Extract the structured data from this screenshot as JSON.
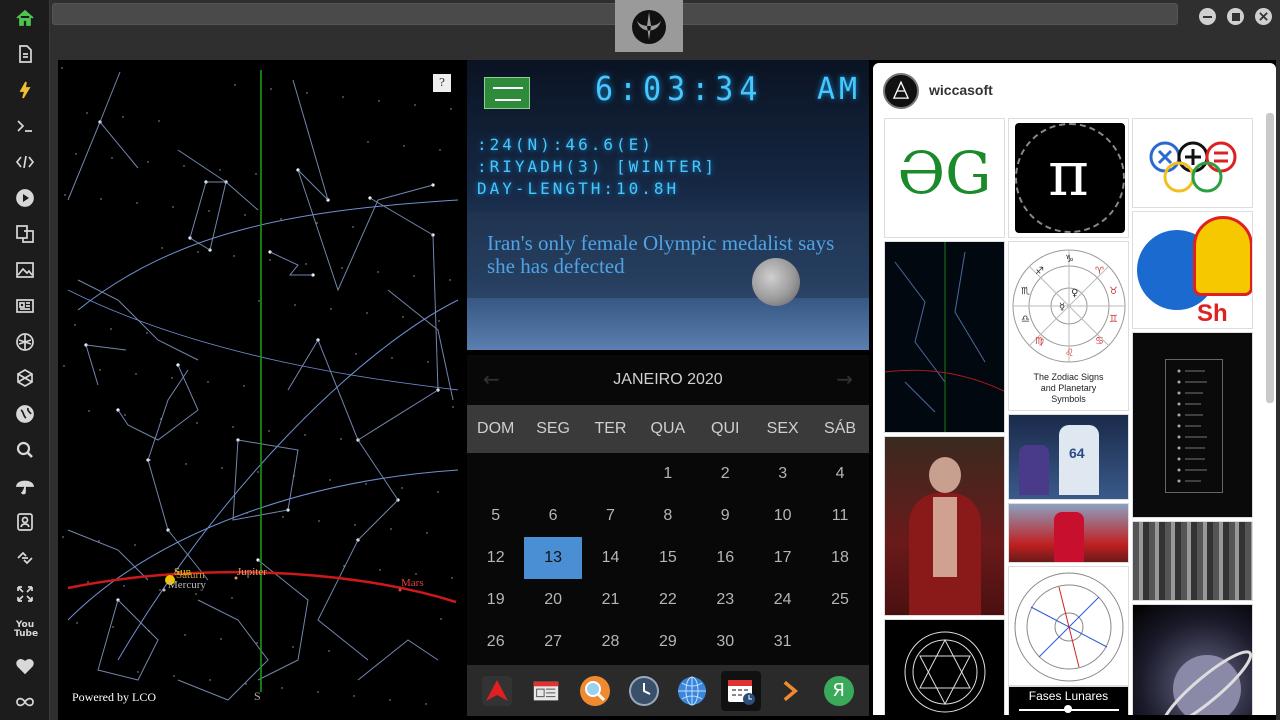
{
  "sidebar": {
    "items": [
      {
        "name": "home",
        "icon": "home-icon"
      },
      {
        "name": "document",
        "icon": "document-icon"
      },
      {
        "name": "lightning",
        "icon": "lightning-icon"
      },
      {
        "name": "terminal",
        "icon": "terminal-icon"
      },
      {
        "name": "code",
        "icon": "code-icon"
      },
      {
        "name": "play",
        "icon": "play-icon"
      },
      {
        "name": "translate",
        "icon": "translate-icon"
      },
      {
        "name": "image",
        "icon": "image-icon"
      },
      {
        "name": "news",
        "icon": "news-icon"
      },
      {
        "name": "rebel",
        "icon": "rebel-icon"
      },
      {
        "name": "hexagon",
        "icon": "hexagon-icon"
      },
      {
        "name": "globe",
        "icon": "globe-icon"
      },
      {
        "name": "search",
        "icon": "search-icon"
      },
      {
        "name": "umbrella",
        "icon": "umbrella-icon"
      },
      {
        "name": "contacts",
        "icon": "contacts-icon"
      },
      {
        "name": "link",
        "icon": "link-icon"
      },
      {
        "name": "fullscreen",
        "icon": "fullscreen-icon"
      },
      {
        "name": "youtube",
        "icon": "youtube-icon",
        "label": "You Tube"
      },
      {
        "name": "heart",
        "icon": "heart-icon"
      },
      {
        "name": "infinity",
        "icon": "infinity-icon"
      }
    ]
  },
  "skymap": {
    "help_label": "?",
    "powered_by": "Powered by LCO",
    "compass_south": "S",
    "planets": [
      {
        "label": "Sun",
        "color": "#f2c200"
      },
      {
        "label": "Saturn",
        "color": "#c8a040"
      },
      {
        "label": "Mercury",
        "color": "#bbbbbb"
      },
      {
        "label": "Jupiter",
        "color": "#d8a070"
      },
      {
        "label": "Mars",
        "color": "#e04040"
      }
    ],
    "colors": {
      "constellation": "#8fa8d8",
      "ecliptic": "#cc1a1a",
      "meridian": "#1a9a1a"
    }
  },
  "clock": {
    "time": "6:03:34",
    "ampm": "AM",
    "coords": ":24(N):46.6(E)",
    "location": ":RIYADH(3) [WINTER]",
    "day_length": "DAY-LENGTH:10.8H",
    "news": "Iran's only female Olympic medalist says she has defected",
    "flag_icon": "saudi-flag-icon"
  },
  "calendar": {
    "month_label": "JANEIRO 2020",
    "prev_icon": "arrow-left-icon",
    "next_icon": "arrow-right-icon",
    "weekdays": [
      "DOM",
      "SEG",
      "TER",
      "QUA",
      "QUI",
      "SEX",
      "SÁB"
    ],
    "weeks": [
      [
        "",
        "",
        "",
        "1",
        "2",
        "3",
        "4"
      ],
      [
        "5",
        "6",
        "7",
        "8",
        "9",
        "10",
        "11"
      ],
      [
        "12",
        "13",
        "14",
        "15",
        "16",
        "17",
        "18"
      ],
      [
        "19",
        "20",
        "21",
        "22",
        "23",
        "24",
        "25"
      ],
      [
        "26",
        "27",
        "28",
        "29",
        "30",
        "31",
        ""
      ]
    ],
    "today": "13",
    "accent": "#4a8fd4"
  },
  "dock": {
    "apps": [
      {
        "name": "arch",
        "icon": "arch-logo-icon"
      },
      {
        "name": "news",
        "icon": "newspaper-icon"
      },
      {
        "name": "search",
        "icon": "magnifier-icon"
      },
      {
        "name": "clock",
        "icon": "clock-icon"
      },
      {
        "name": "globe",
        "icon": "globe-icon"
      },
      {
        "name": "calendar",
        "icon": "calendar-icon",
        "active": true
      },
      {
        "name": "next",
        "icon": "chevron-right-icon"
      },
      {
        "name": "ya",
        "icon": "ya-icon",
        "label": "Я"
      }
    ]
  },
  "pinterest": {
    "username": "wiccasoft",
    "tiles": {
      "zodiac_caption": "The Zodiac Signs and Planetary Symbols",
      "fases_caption": "Fases Lunares",
      "pi_symbol": "π",
      "gg_text": "ƏG",
      "shell_text": "Sh",
      "player_number": "64"
    }
  }
}
